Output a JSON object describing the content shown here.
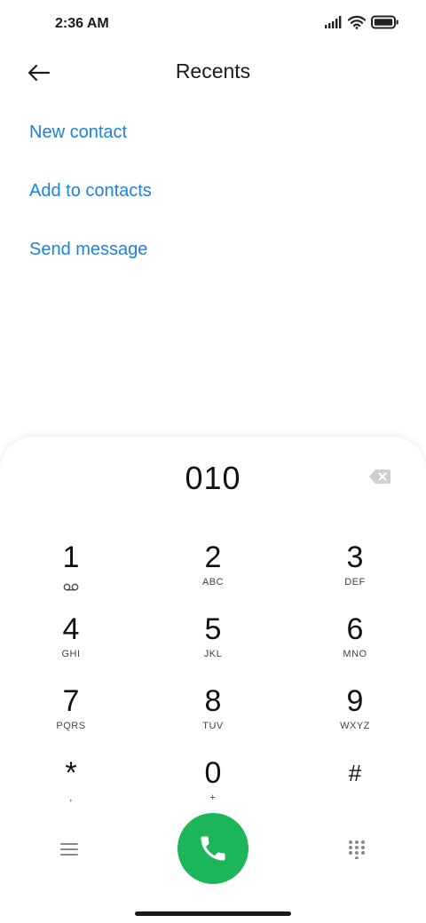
{
  "status_bar": {
    "time": "2:36 AM",
    "icons": [
      "signal-icon",
      "wifi-icon",
      "battery-icon"
    ]
  },
  "header": {
    "title": "Recents",
    "back_icon": "back-arrow-icon"
  },
  "actions": {
    "new_contact": "New contact",
    "add_to_contacts": "Add to contacts",
    "send_message": "Send message"
  },
  "dialpad": {
    "number": "010",
    "keys": [
      {
        "digit": "1",
        "letters": ""
      },
      {
        "digit": "2",
        "letters": "ABC"
      },
      {
        "digit": "3",
        "letters": "DEF"
      },
      {
        "digit": "4",
        "letters": "GHI"
      },
      {
        "digit": "5",
        "letters": "JKL"
      },
      {
        "digit": "6",
        "letters": "MNO"
      },
      {
        "digit": "7",
        "letters": "PQRS"
      },
      {
        "digit": "8",
        "letters": "TUV"
      },
      {
        "digit": "9",
        "letters": "WXYZ"
      },
      {
        "digit": "*",
        "letters": ","
      },
      {
        "digit": "0",
        "letters": "+"
      },
      {
        "digit": "#",
        "letters": ""
      }
    ]
  },
  "colors": {
    "accent": "#1a82e0",
    "call": "#1db55a",
    "background": "#ffffff"
  }
}
